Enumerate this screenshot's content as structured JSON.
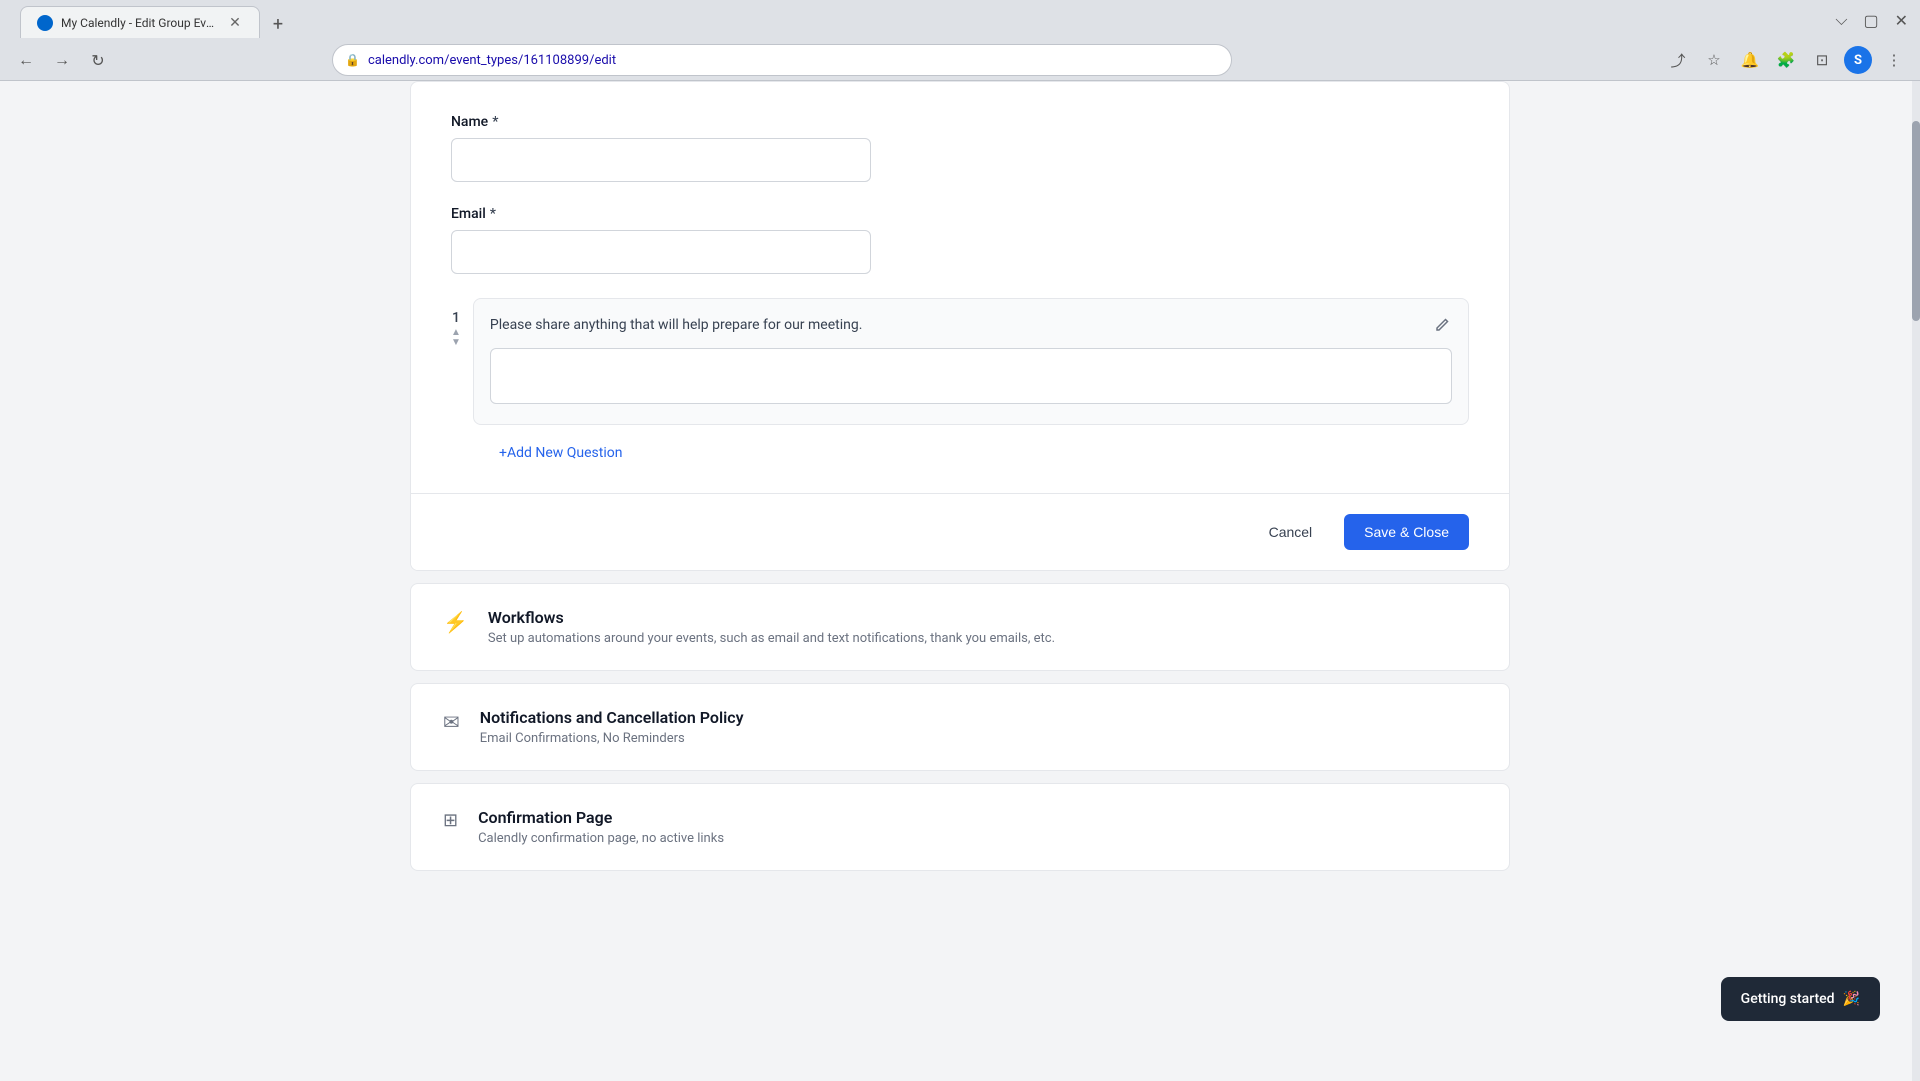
{
  "browser": {
    "tab_title": "My Calendly - Edit Group Event",
    "tab_favicon_text": "C",
    "url": "calendly.com/event_types/161108899/edit",
    "new_tab_label": "+",
    "nav_back": "←",
    "nav_forward": "→",
    "nav_refresh": "↻",
    "profile_initial": "S"
  },
  "form": {
    "name_label": "Name",
    "name_required": "*",
    "email_label": "Email",
    "email_required": "*",
    "question_number": "1",
    "question_text": "Please share anything that will help prepare for our meeting.",
    "add_question_label": "+ Add New Question",
    "cancel_label": "Cancel",
    "save_close_label": "Save & Close"
  },
  "sections": [
    {
      "icon": "⚡",
      "icon_class": "lightning",
      "title": "Workflows",
      "desc": "Set up automations around your events, such as email and text notifications, thank you emails, etc."
    },
    {
      "icon": "✉",
      "icon_class": "",
      "title": "Notifications and Cancellation Policy",
      "desc": "Email Confirmations, No Reminders"
    },
    {
      "icon": "⊞",
      "icon_class": "",
      "title": "Confirmation Page",
      "desc": "Calendly confirmation page, no active links"
    }
  ],
  "toast": {
    "label": "Getting started",
    "emoji": "🎉"
  }
}
